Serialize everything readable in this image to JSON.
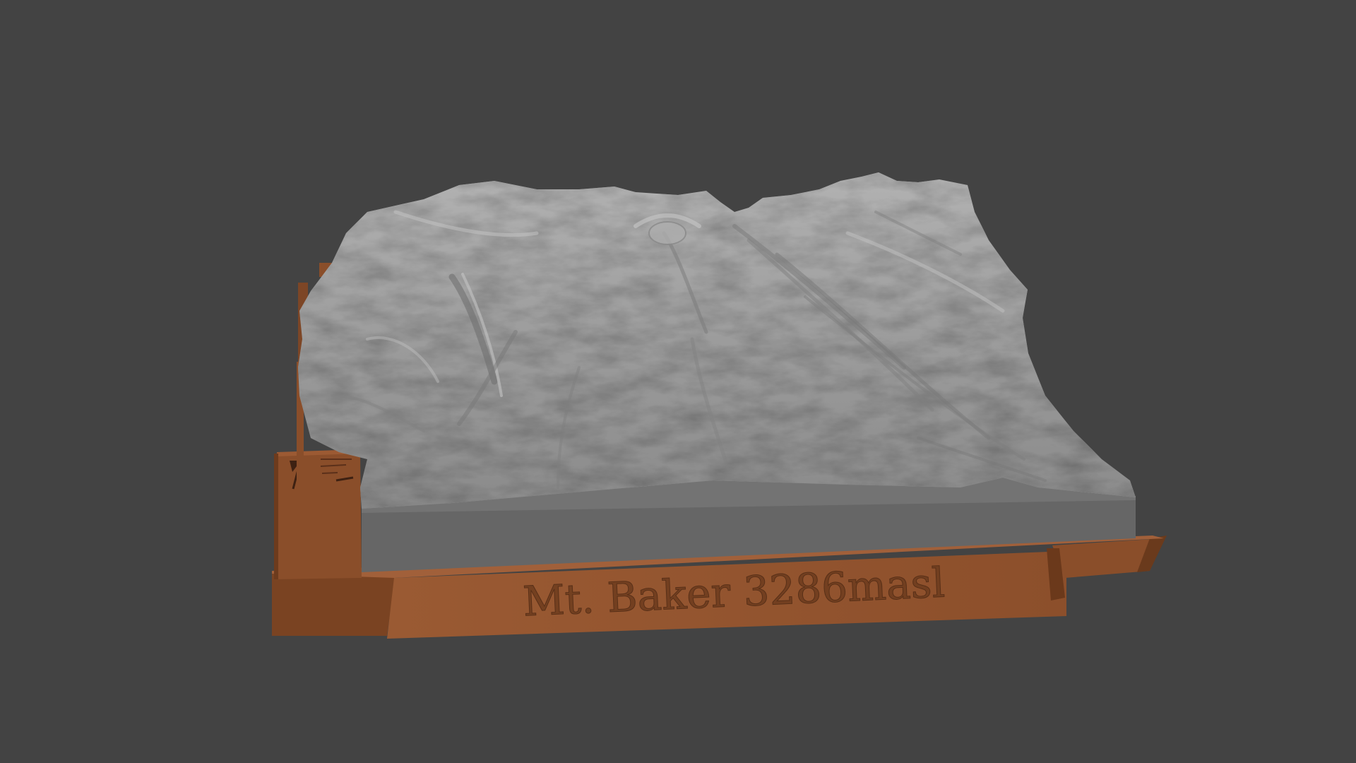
{
  "scene": {
    "background_color": "#434343",
    "terrain_color": "#9a9a9a",
    "terrain_side_color": "#666666",
    "base_color": "#8a4e2a",
    "base_dark_color": "#5e3318",
    "base_light_color": "#a25e34"
  },
  "model": {
    "plate_text": "Mt. Baker 3286masl"
  },
  "legend_icons": [
    "north-arrow-icon",
    "scale-bar-icon"
  ]
}
